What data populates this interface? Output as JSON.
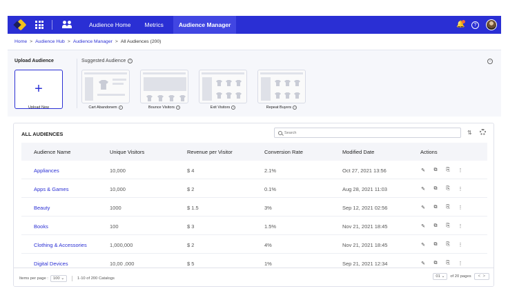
{
  "nav": {
    "items": [
      "Audience Home",
      "Metrics",
      "Audience Manager"
    ]
  },
  "breadcrumb": [
    "Home",
    "Audience Hub",
    "Audience Manager",
    "All Audiences (200)"
  ],
  "upload": {
    "title": "Upload Audience",
    "suggested_title": "Suggested Audience",
    "upload_new_label": "Upload New",
    "suggestions": [
      "Cart Abandonem",
      "Bounce Visitors",
      "Exit Visitors",
      "Repeat Buyers"
    ]
  },
  "audiences": {
    "title": "ALL AUDIENCES",
    "search_placeholder": "Search",
    "columns": [
      "Audience Name",
      "Unique Visitors",
      "Revenue per Visitor",
      "Conversion Rate",
      "Modified Date",
      "Actions"
    ],
    "rows": [
      {
        "name": "Appliances",
        "visitors": "10,000",
        "revenue": "$ 4",
        "conversion": "2.1%",
        "date": "Oct 27, 2021 13:56"
      },
      {
        "name": "Apps & Games",
        "visitors": "10,000",
        "revenue": "$ 2",
        "conversion": "0.1%",
        "date": "Aug 28, 2021 11:03"
      },
      {
        "name": "Beauty",
        "visitors": "1000",
        "revenue": "$ 1.5",
        "conversion": "3%",
        "date": "Sep 12, 2021 02:56"
      },
      {
        "name": "Books",
        "visitors": "100",
        "revenue": "$ 3",
        "conversion": "1.5%",
        "date": "Nov 21, 2021 18:45"
      },
      {
        "name": "Clothing & Accessories",
        "visitors": "1,000,000",
        "revenue": "$ 2",
        "conversion": "4%",
        "date": "Nov 21, 2021 18:45"
      },
      {
        "name": "Digital Devices",
        "visitors": "10,00 ,000",
        "revenue": "$ 5",
        "conversion": "1%",
        "date": "Sep 21, 2021 12:34"
      }
    ]
  },
  "footer": {
    "items_per_page_label": "Items per page :",
    "items_per_page_value": "100",
    "range": "1-10 of 200 Catalogs",
    "page_value": "01",
    "pages_label": "of 20 pages"
  },
  "colors": {
    "accent": "#2a2fd4",
    "logo_yellow": "#f2c21b",
    "notification": "#f26a3d"
  }
}
